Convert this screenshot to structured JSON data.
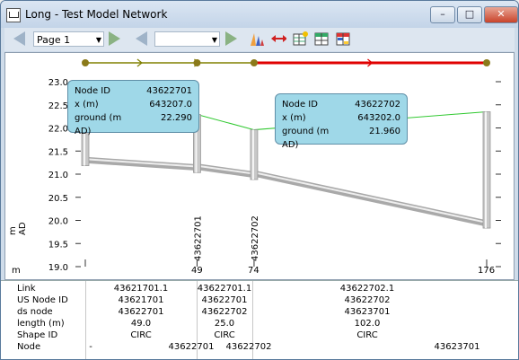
{
  "window": {
    "title": "Long - Test Model Network",
    "minimize": "–",
    "maximize": "□",
    "close": "✕"
  },
  "toolbar": {
    "page_value": "Page 1",
    "second_value": ""
  },
  "chart_data": {
    "type": "line",
    "ylabel": "m AD",
    "ylim": [
      19.0,
      23.0
    ],
    "yticks": [
      19.0,
      19.5,
      20.0,
      20.5,
      21.0,
      21.5,
      22.0,
      22.5,
      23.0
    ],
    "x_label": "m",
    "x_ticks": [
      49,
      74,
      176
    ],
    "ground_level": {
      "x": [
        0,
        49,
        74,
        176
      ],
      "y": [
        21.9,
        22.29,
        21.96,
        22.35
      ]
    },
    "pipe": {
      "x": [
        0,
        49,
        74,
        176
      ],
      "y": [
        21.3,
        21.15,
        21.0,
        19.95
      ]
    },
    "node_labels": [
      "43622701",
      "43622702"
    ],
    "links": [
      {
        "name": "43621701.1"
      },
      {
        "name": "43622701.1"
      },
      {
        "name": "43622702.1"
      }
    ]
  },
  "callouts": [
    {
      "node_id_label": "Node ID",
      "node_id": "43622701",
      "x_label": "x (m)",
      "x": "643207.0",
      "ground_label": "ground (m AD)",
      "ground": "22.290"
    },
    {
      "node_id_label": "Node ID",
      "node_id": "43622702",
      "x_label": "x (m)",
      "x": "643202.0",
      "ground_label": "ground (m AD)",
      "ground": "21.960"
    }
  ],
  "table": {
    "rows": {
      "link": "Link",
      "us_node": "US Node ID",
      "ds_node": "ds node",
      "length": "length (m)",
      "shape": "Shape ID",
      "node": "Node"
    },
    "columns": [
      {
        "link": "43621701.1",
        "us": "43621701",
        "ds": "43622701",
        "len": "49.0",
        "shape": "CIRC"
      },
      {
        "link": "43622701.1",
        "us": "43622701",
        "ds": "43622702",
        "len": "25.0",
        "shape": "CIRC"
      },
      {
        "link": "43622702.1",
        "us": "43622702",
        "ds": "43623701",
        "len": "102.0",
        "shape": "CIRC"
      }
    ],
    "node_row": [
      "-",
      "43622701",
      "43622702",
      "43623701"
    ]
  },
  "colors": {
    "ground": "#2ec82e",
    "pipe": "#c8c8c8",
    "link": "#e00000",
    "link2": "#808000",
    "callout": "#9fd8e8"
  }
}
